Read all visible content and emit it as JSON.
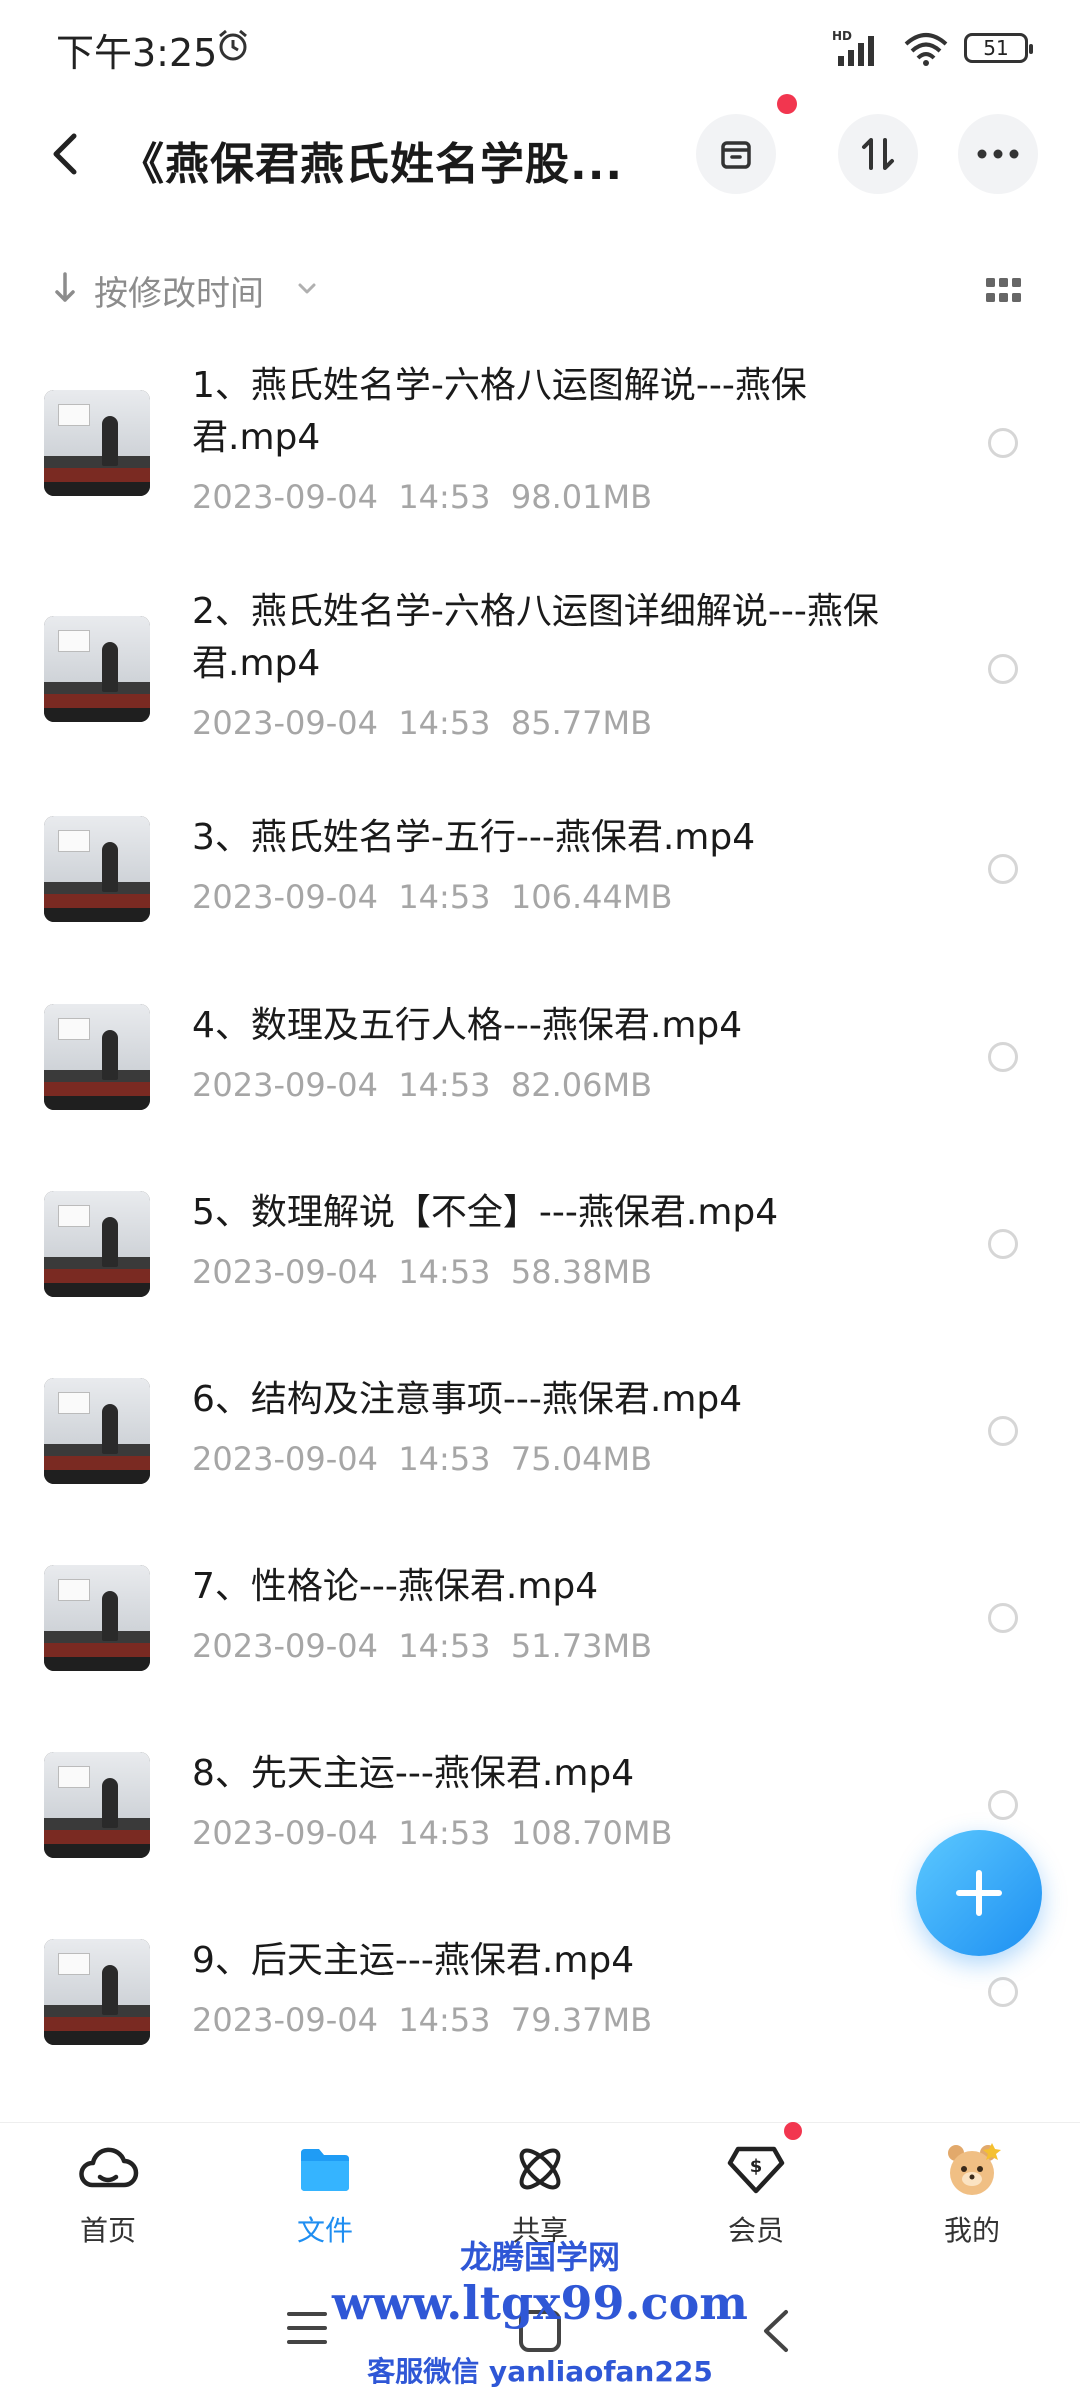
{
  "status_bar": {
    "time": "下午3:25",
    "network": "HD",
    "battery": "51"
  },
  "header": {
    "title": "《燕保君燕氏姓名学股..."
  },
  "sort": {
    "label": "按修改时间"
  },
  "files": [
    {
      "name": "1、燕氏姓名学-六格八运图解说---燕保君.mp4",
      "date": "2023-09-04",
      "time": "14:53",
      "size": "98.01MB"
    },
    {
      "name": "2、燕氏姓名学-六格八运图详细解说---燕保君.mp4",
      "date": "2023-09-04",
      "time": "14:53",
      "size": "85.77MB"
    },
    {
      "name": "3、燕氏姓名学-五行---燕保君.mp4",
      "date": "2023-09-04",
      "time": "14:53",
      "size": "106.44MB"
    },
    {
      "name": "4、数理及五行人格---燕保君.mp4",
      "date": "2023-09-04",
      "time": "14:53",
      "size": "82.06MB"
    },
    {
      "name": "5、数理解说【不全】---燕保君.mp4",
      "date": "2023-09-04",
      "time": "14:53",
      "size": "58.38MB"
    },
    {
      "name": "6、结构及注意事项---燕保君.mp4",
      "date": "2023-09-04",
      "time": "14:53",
      "size": "75.04MB"
    },
    {
      "name": "7、性格论---燕保君.mp4",
      "date": "2023-09-04",
      "time": "14:53",
      "size": "51.73MB"
    },
    {
      "name": "8、先天主运---燕保君.mp4",
      "date": "2023-09-04",
      "time": "14:53",
      "size": "108.70MB"
    },
    {
      "name": "9、后天主运---燕保君.mp4",
      "date": "2023-09-04",
      "time": "14:53",
      "size": "79.37MB"
    }
  ],
  "bottom_nav": [
    {
      "label": "首页",
      "icon": "cloud-icon"
    },
    {
      "label": "文件",
      "icon": "folder-icon",
      "active": true
    },
    {
      "label": "共享",
      "icon": "atom-icon"
    },
    {
      "label": "会员",
      "icon": "diamond-icon"
    },
    {
      "label": "我的",
      "icon": "avatar-icon"
    }
  ],
  "watermark": {
    "line1": "龙腾国学网",
    "line2": "www.ltgx99.com",
    "line3": "客服微信 yanliaofan225"
  },
  "colors": {
    "accent": "#1f8ef1",
    "badge": "#f2364f",
    "meta_text": "#a6a6a6",
    "watermark": "#2f57d6"
  }
}
